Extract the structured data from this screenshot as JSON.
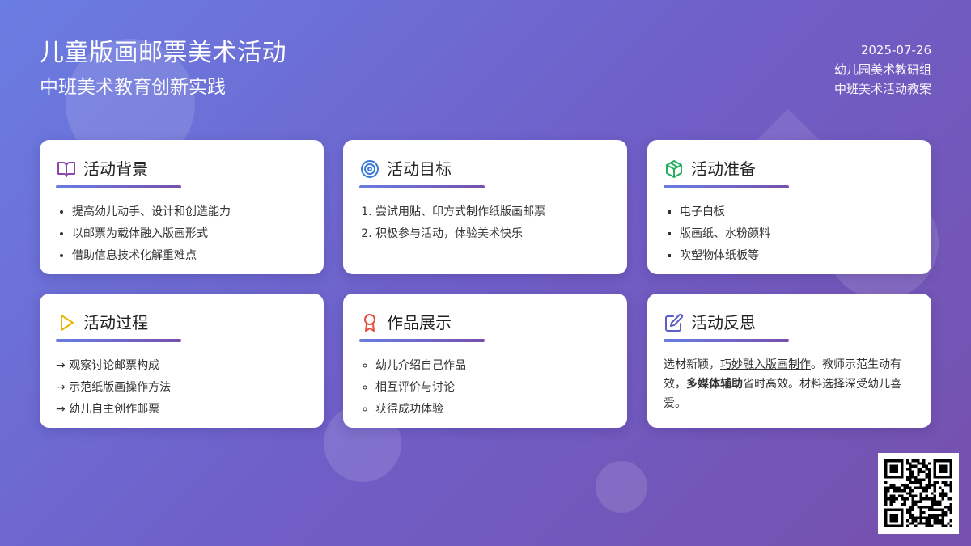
{
  "header": {
    "title": "儿童版画邮票美术活动",
    "subtitle": "中班美术教育创新实践",
    "date": "2025-07-26",
    "org": "幼儿园美术教研组",
    "doc_type": "中班美术活动教案"
  },
  "cards": [
    {
      "title": "活动背景",
      "icon": "book-icon",
      "items": [
        "提高幼儿动手、设计和创造能力",
        "以邮票为载体融入版画形式",
        "借助信息技术化解重难点"
      ]
    },
    {
      "title": "活动目标",
      "icon": "target-icon",
      "items": [
        "尝试用贴、印方式制作纸版画邮票",
        "积极参与活动，体验美术快乐"
      ]
    },
    {
      "title": "活动准备",
      "icon": "box-icon",
      "items": [
        "电子白板",
        "版画纸、水粉颜料",
        "吹塑物体纸板等"
      ]
    },
    {
      "title": "活动过程",
      "icon": "play-icon",
      "items": [
        "→ 观察讨论邮票构成",
        "→ 示范纸版画操作方法",
        "→ 幼儿自主创作邮票"
      ]
    },
    {
      "title": "作品展示",
      "icon": "award-icon",
      "items": [
        "幼儿介绍自己作品",
        "相互评价与讨论",
        "获得成功体验"
      ]
    },
    {
      "title": "活动反思",
      "icon": "edit-icon",
      "para": {
        "p1": "选材新颖，",
        "u": "巧妙融入版画制作",
        "p2": "。教师示范生动有效，",
        "b": "多媒体辅助",
        "p3": "省时高效。材料选择深受幼儿喜爱。"
      }
    }
  ],
  "colors": {
    "accent_start": "#6a7de2",
    "accent_end": "#7650ac",
    "book": "#8e44ad",
    "target": "#3a7bd5",
    "box": "#27ae60",
    "play": "#e6b400",
    "award": "#e74c3c",
    "edit": "#5b5fc7"
  }
}
